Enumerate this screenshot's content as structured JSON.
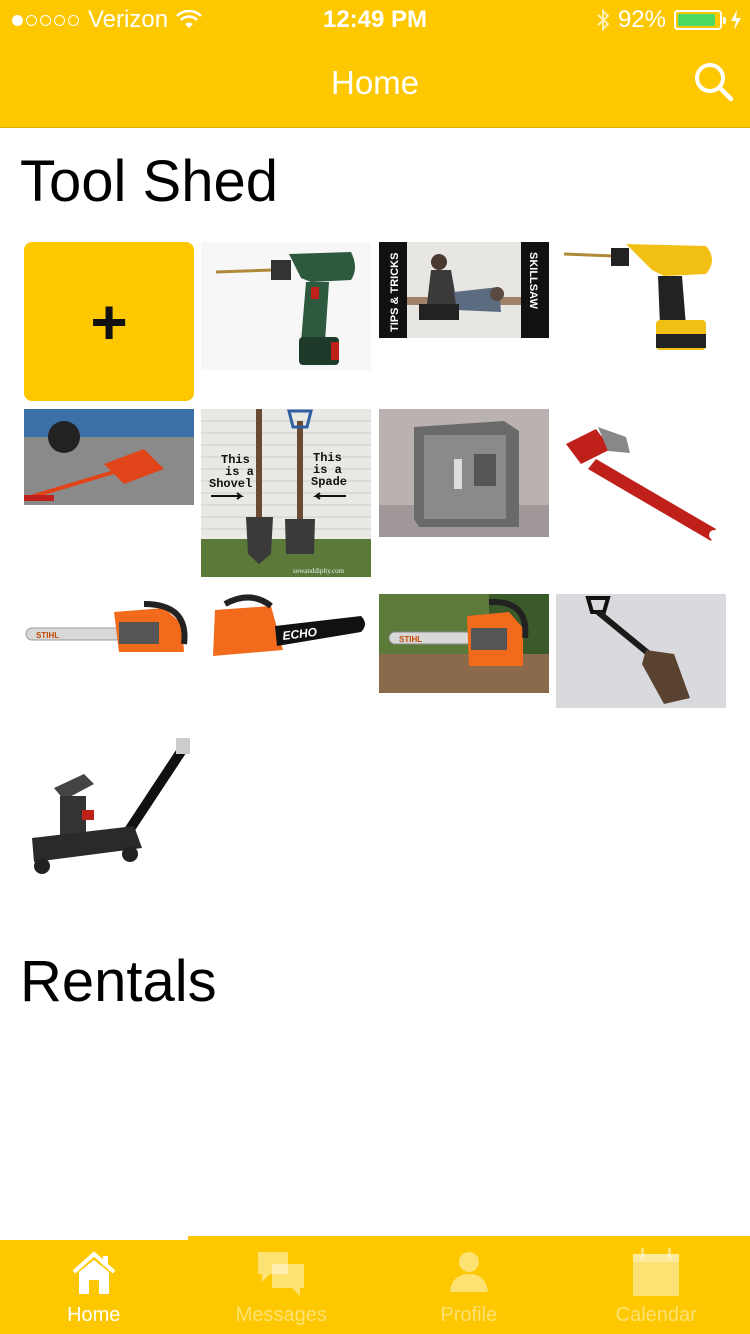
{
  "status_bar": {
    "carrier": "Verizon",
    "time": "12:49 PM",
    "battery": "92%",
    "battery_level": 0.92,
    "signal_bars": 1
  },
  "nav": {
    "title": "Home",
    "search_icon": "search-icon"
  },
  "sections": {
    "tool_shed": "Tool Shed",
    "rentals": "Rentals"
  },
  "add_tile": {
    "label": "+",
    "icon": "plus-icon"
  },
  "tools": [
    {
      "name": "cordless drill green",
      "tips_text": "",
      "brand": ""
    },
    {
      "name": "skillsaw tips video",
      "tips_text": "TIPS & TRICKS",
      "brand": "SKILLSAW"
    },
    {
      "name": "cordless drill yellow",
      "tips_text": "",
      "brand": ""
    },
    {
      "name": "scissor car jack",
      "tips_text": "",
      "brand": ""
    },
    {
      "name": "shovel and spade",
      "left_sign": [
        "This",
        "is a",
        "Shovel"
      ],
      "right_sign": [
        "This",
        "is a",
        "Spade"
      ],
      "footer": "sowanddiplty.com"
    },
    {
      "name": "safe",
      "tips_text": "",
      "brand": ""
    },
    {
      "name": "pipe wrench",
      "tips_text": "",
      "brand": ""
    },
    {
      "name": "stihl chainsaw",
      "brand": "STIHL"
    },
    {
      "name": "echo chainsaw",
      "brand": "ECHO"
    },
    {
      "name": "chainsaw on porch",
      "brand": "STIHL"
    },
    {
      "name": "garden spade",
      "tips_text": "",
      "brand": ""
    },
    {
      "name": "floor jack",
      "tips_text": "",
      "brand": ""
    }
  ],
  "tabs": [
    {
      "label": "Home",
      "icon": "home-icon",
      "active": true
    },
    {
      "label": "Messages",
      "icon": "messages-icon",
      "active": false
    },
    {
      "label": "Profile",
      "icon": "profile-icon",
      "active": false
    },
    {
      "label": "Calendar",
      "icon": "calendar-icon",
      "active": false
    }
  ],
  "colors": {
    "accent": "#fdc800",
    "battery": "#4cd964",
    "text": "#000000"
  }
}
